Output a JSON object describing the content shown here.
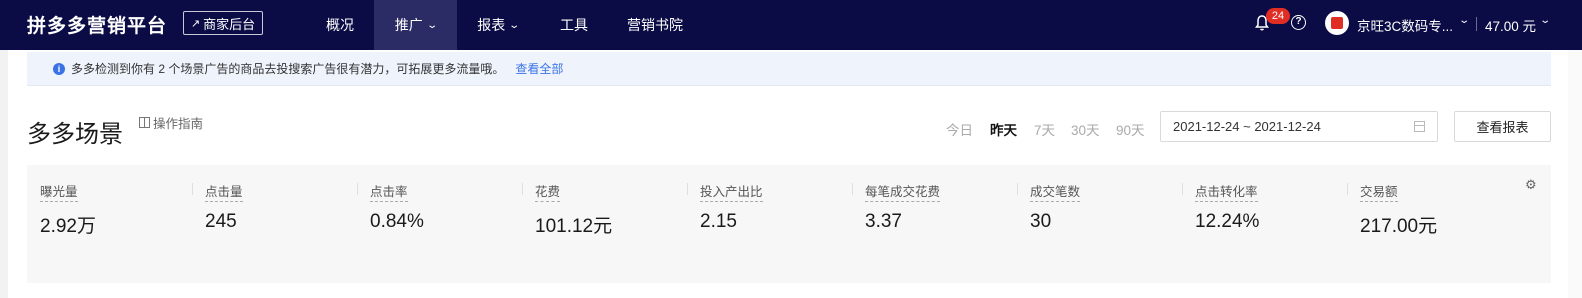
{
  "topbar": {
    "brand": "拼多多营销平台",
    "merchant_button": "商家后台",
    "nav": [
      {
        "label": "概况",
        "dropdown": false,
        "active": false
      },
      {
        "label": "推广",
        "dropdown": true,
        "active": true
      },
      {
        "label": "报表",
        "dropdown": true,
        "active": false
      },
      {
        "label": "工具",
        "dropdown": false,
        "active": false
      },
      {
        "label": "营销书院",
        "dropdown": false,
        "active": false
      }
    ],
    "notification_count": "24",
    "shop_name": "京旺3C数码专...",
    "balance": "47.00 元"
  },
  "notice": {
    "text": "多多检测到你有 2 个场景广告的商品去投搜索广告很有潜力，可拓展更多流量哦。",
    "link": "查看全部"
  },
  "header": {
    "title": "多多场景",
    "guide": "操作指南",
    "ranges": [
      "今日",
      "昨天",
      "7天",
      "30天",
      "90天"
    ],
    "active_range": "昨天",
    "date_range": "2021-12-24 ~ 2021-12-24",
    "report_button": "查看报表"
  },
  "metrics": [
    {
      "label": "曝光量",
      "value": "2.92万"
    },
    {
      "label": "点击量",
      "value": "245"
    },
    {
      "label": "点击率",
      "value": "0.84%"
    },
    {
      "label": "花费",
      "value": "101.12元"
    },
    {
      "label": "投入产出比",
      "value": "2.15"
    },
    {
      "label": "每笔成交花费",
      "value": "3.37"
    },
    {
      "label": "成交笔数",
      "value": "30"
    },
    {
      "label": "点击转化率",
      "value": "12.24%"
    },
    {
      "label": "交易额",
      "value": "217.00元"
    }
  ],
  "colors": {
    "nav_bg": "#0b0b45",
    "nav_active": "#2b2b66",
    "accent": "#3b73e6",
    "badge": "#e02e24"
  }
}
